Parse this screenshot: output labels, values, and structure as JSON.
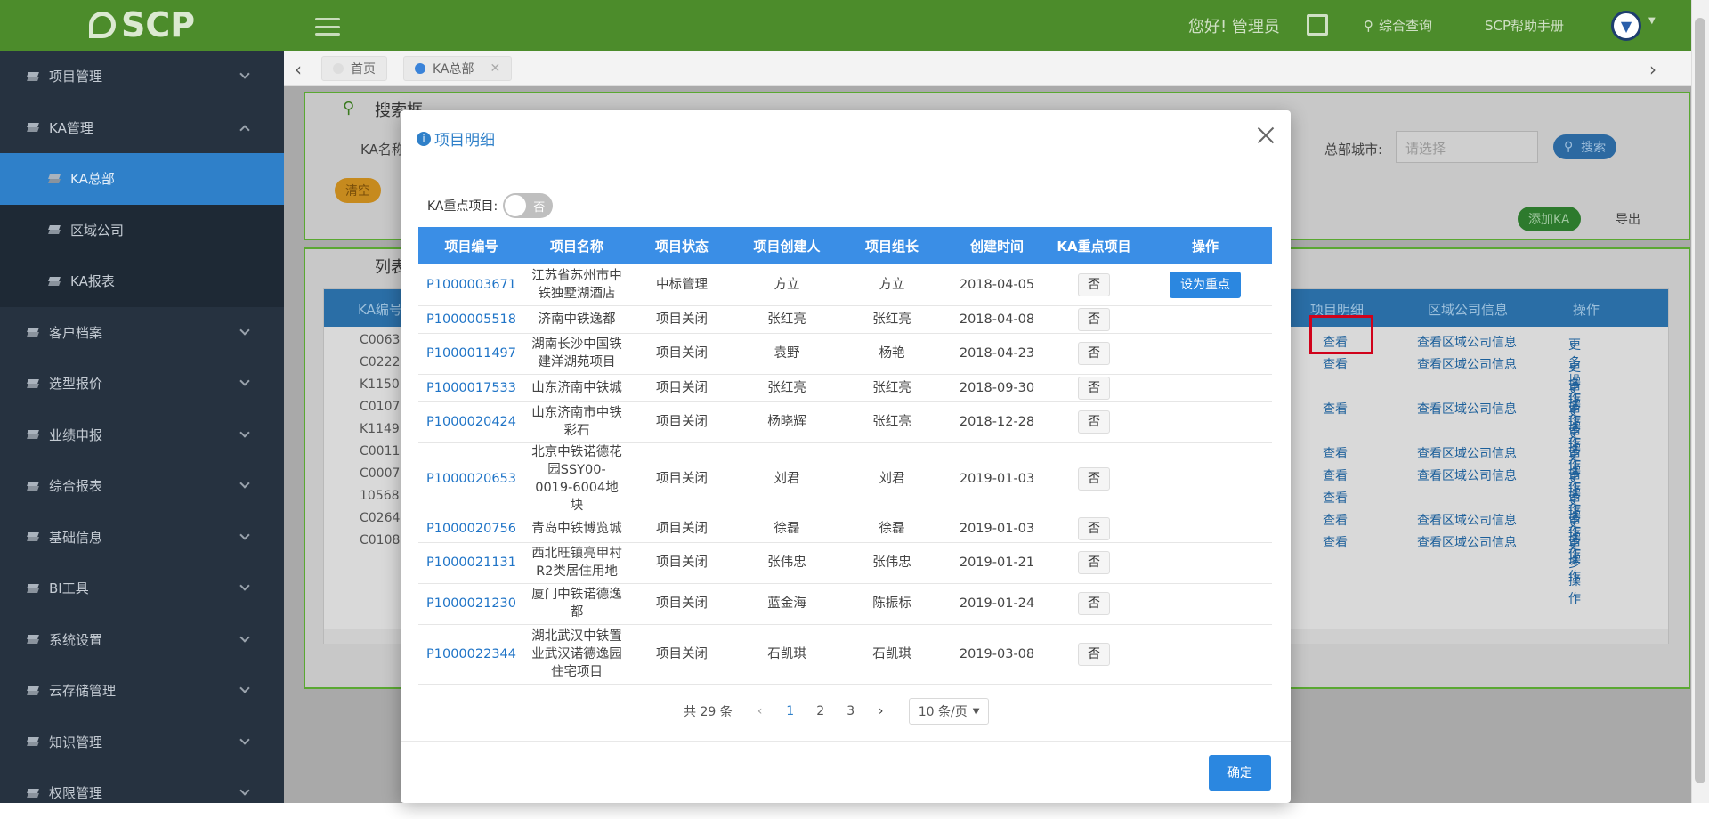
{
  "topbar": {
    "logo": "SCP",
    "greeting": "您好! 管理员",
    "query": "综合查询",
    "help": "SCP帮助手册"
  },
  "sidebar": {
    "items": [
      {
        "label": "项目管理"
      },
      {
        "label": "KA管理"
      },
      {
        "label": "KA总部"
      },
      {
        "label": "区域公司"
      },
      {
        "label": "KA报表"
      },
      {
        "label": "客户档案"
      },
      {
        "label": "选型报价"
      },
      {
        "label": "业绩申报"
      },
      {
        "label": "综合报表"
      },
      {
        "label": "基础信息"
      },
      {
        "label": "BI工具"
      },
      {
        "label": "系统设置"
      },
      {
        "label": "云存储管理"
      },
      {
        "label": "知识管理"
      },
      {
        "label": "权限管理"
      }
    ]
  },
  "tabs": [
    {
      "label": "首页"
    },
    {
      "label": "KA总部"
    }
  ],
  "background": {
    "search_title": "搜索框",
    "name_label": "KA名称",
    "clear": "清空",
    "city_label": "总部城市:",
    "city_placeholder": "请选择",
    "search_btn": "搜索",
    "add_btn": "添加KA",
    "export_btn": "导出",
    "list_title": "列表",
    "cols": [
      "KA编号",
      "项目明细",
      "区域公司信息",
      "操作"
    ],
    "view": "查看",
    "view_region": "查看区域公司信息",
    "more": "更多操作",
    "rows": [
      {
        "code": "C0063",
        "view": true,
        "region": true
      },
      {
        "code": "C0222",
        "view": true,
        "region": true
      },
      {
        "code": "K1150",
        "view": false,
        "region": false
      },
      {
        "code": "C0107",
        "view": true,
        "region": true
      },
      {
        "code": "K1149",
        "view": false,
        "region": false
      },
      {
        "code": "C0011",
        "view": true,
        "region": true
      },
      {
        "code": "C0007",
        "view": true,
        "region": true
      },
      {
        "code": "10568",
        "view": true,
        "region": false
      },
      {
        "code": "C0264",
        "view": true,
        "region": true
      },
      {
        "code": "C0108",
        "view": true,
        "region": true
      }
    ]
  },
  "modal": {
    "title": "项目明细",
    "filter_label": "KA重点项目:",
    "switch_text": "否",
    "columns": [
      "项目编号",
      "项目名称",
      "项目状态",
      "项目创建人",
      "项目组长",
      "创建时间",
      "KA重点项目",
      "操作"
    ],
    "rows": [
      {
        "code": "P1000003671",
        "name": "江苏省苏州市中铁独墅湖酒店",
        "status": "中标管理",
        "creator": "方立",
        "leader": "方立",
        "date": "2018-04-05",
        "key": "否",
        "action": "设为重点"
      },
      {
        "code": "P1000005518",
        "name": "济南中铁逸都",
        "status": "项目关闭",
        "creator": "张红亮",
        "leader": "张红亮",
        "date": "2018-04-08",
        "key": "否",
        "action": ""
      },
      {
        "code": "P1000011497",
        "name": "湖南长沙中国铁建洋湖苑项目",
        "status": "项目关闭",
        "creator": "袁野",
        "leader": "杨艳",
        "date": "2018-04-23",
        "key": "否",
        "action": ""
      },
      {
        "code": "P1000017533",
        "name": "山东济南中铁城",
        "status": "项目关闭",
        "creator": "张红亮",
        "leader": "张红亮",
        "date": "2018-09-30",
        "key": "否",
        "action": ""
      },
      {
        "code": "P1000020424",
        "name": "山东济南市中铁彩石",
        "status": "项目关闭",
        "creator": "杨晓辉",
        "leader": "张红亮",
        "date": "2018-12-28",
        "key": "否",
        "action": ""
      },
      {
        "code": "P1000020653",
        "name": "北京中铁诺德花园SSY00-0019-6004地块",
        "status": "项目关闭",
        "creator": "刘君",
        "leader": "刘君",
        "date": "2019-01-03",
        "key": "否",
        "action": ""
      },
      {
        "code": "P1000020756",
        "name": "青岛中铁博览城",
        "status": "项目关闭",
        "creator": "徐磊",
        "leader": "徐磊",
        "date": "2019-01-03",
        "key": "否",
        "action": ""
      },
      {
        "code": "P1000021131",
        "name": "西北旺镇亮甲村R2类居住用地",
        "status": "项目关闭",
        "creator": "张伟忠",
        "leader": "张伟忠",
        "date": "2019-01-21",
        "key": "否",
        "action": ""
      },
      {
        "code": "P1000021230",
        "name": "厦门中铁诺德逸都",
        "status": "项目关闭",
        "creator": "蓝金海",
        "leader": "陈振标",
        "date": "2019-01-24",
        "key": "否",
        "action": ""
      },
      {
        "code": "P1000022344",
        "name": "湖北武汉中铁置业武汉诺德逸园住宅项目",
        "status": "项目关闭",
        "creator": "石凯琪",
        "leader": "石凯琪",
        "date": "2019-03-08",
        "key": "否",
        "action": ""
      }
    ],
    "pager": {
      "total": "共 29 条",
      "pages": [
        "1",
        "2",
        "3"
      ],
      "size": "10 条/页"
    },
    "ok": "确定"
  }
}
